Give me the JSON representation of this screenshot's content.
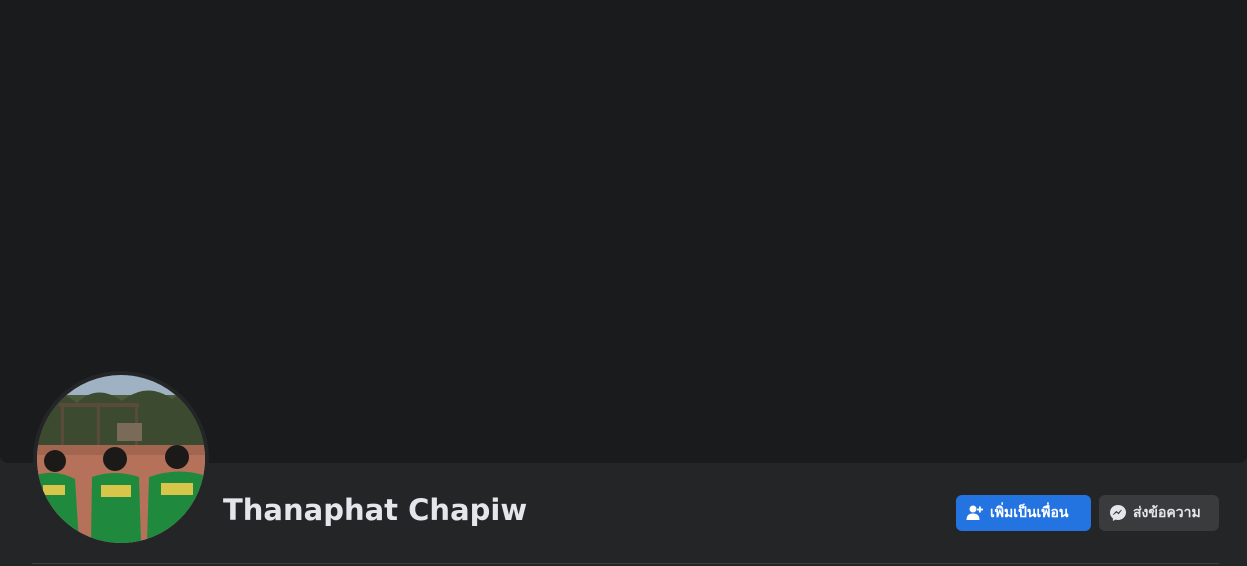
{
  "profile": {
    "name": "Thanaphat Chapiw"
  },
  "actions": {
    "add_friend_label": "เพิ่มเป็นเพื่อน",
    "add_friend_icon": "add-friend-icon",
    "message_label": "ส่งข้อความ",
    "message_icon": "messenger-icon"
  },
  "colors": {
    "background": "#242526",
    "cover": "#1a1b1d",
    "primary_button": "#2374e1",
    "secondary_button": "#3a3b3c",
    "text": "#e4e6eb"
  }
}
